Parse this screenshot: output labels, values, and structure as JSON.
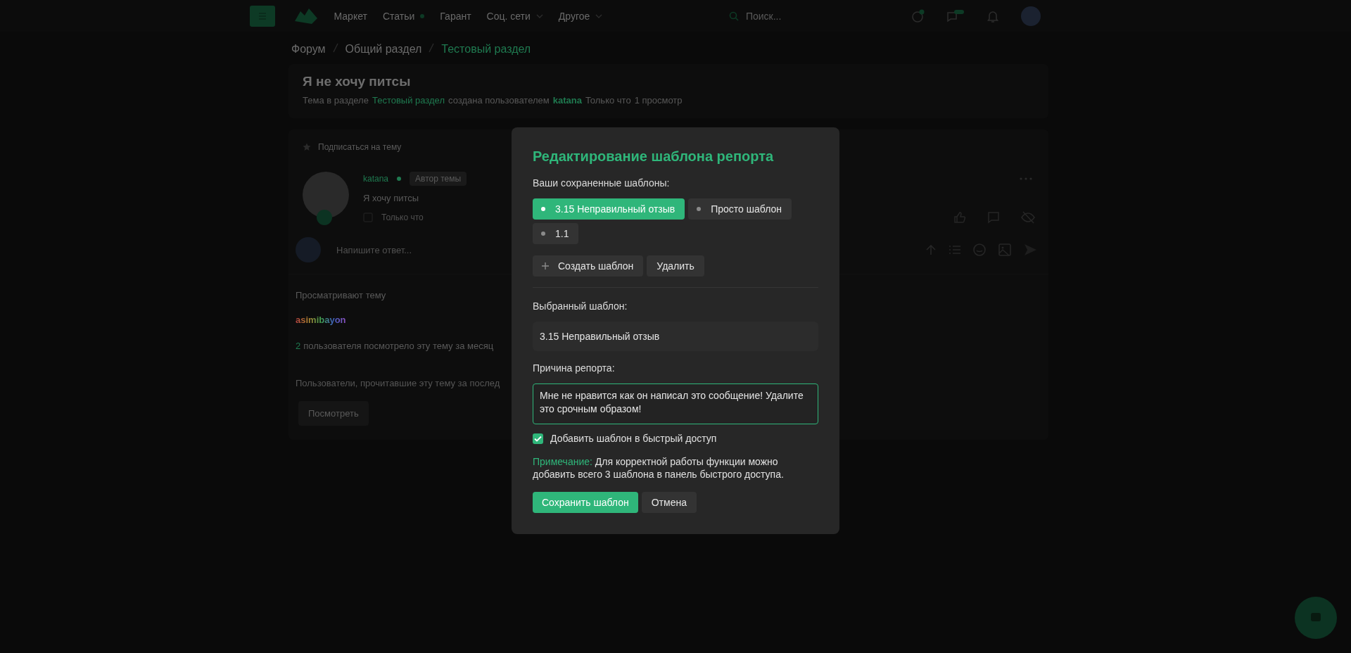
{
  "nav": {
    "items": [
      {
        "label": "Маркет",
        "kind": "plain"
      },
      {
        "label": "Статьи",
        "kind": "dot"
      },
      {
        "label": "Гарант",
        "kind": "plain"
      },
      {
        "label": "Соц. сети",
        "kind": "dropdown"
      },
      {
        "label": "Другое",
        "kind": "dropdown"
      }
    ],
    "search": {
      "placeholder": "Поиск..."
    }
  },
  "breadcrumbs": [
    {
      "label": "Форум",
      "current": false
    },
    {
      "label": "Общий раздел",
      "current": false
    },
    {
      "label": "Тестовый раздел",
      "current": true
    }
  ],
  "thread": {
    "title": "Я не хочу питсы",
    "meta": [
      {
        "text": "Тема в разделе",
        "kind": "plain"
      },
      {
        "text": "Тестовый раздел",
        "kind": "link"
      },
      {
        "text": "создана пользователем",
        "kind": "plain"
      },
      {
        "text": "katana",
        "kind": "user"
      },
      {
        "text": "Только что",
        "kind": "plain"
      },
      {
        "text": "1 просмотр",
        "kind": "plain"
      }
    ]
  },
  "post": {
    "subscribe": "Подписаться на тему",
    "author": "katana",
    "author_badge": "Автор темы",
    "text": "Я хочу питсы",
    "time": "Только что",
    "reply_placeholder": "Напишите ответ..."
  },
  "viewers": {
    "heading": "Просматривают тему",
    "users": [
      "asimibayon"
    ],
    "month_count": "2",
    "month_text": "пользователя посмотрело эту тему за месяц",
    "readers_text": "Пользователи, прочитавшие эту тему за послед",
    "readers_button": "Посмотреть"
  },
  "modal": {
    "title": "Редактирование шаблона репорта",
    "saved_label": "Ваши сохраненные шаблоны:",
    "templates": [
      {
        "label": "3.15 Неправильный отзыв",
        "selected": true
      },
      {
        "label": "Просто шаблон",
        "selected": false
      },
      {
        "label": "1.1",
        "selected": false
      }
    ],
    "create_button": "Создать шаблон",
    "delete_button": "Удалить",
    "selected_label": "Выбранный шаблон:",
    "selected_value": "3.15 Неправильный отзыв",
    "reason_label": "Причина репорта:",
    "reason_value": "Мне не нравится как он написал это сообщение! Удалите это срочным образом!",
    "quick_access": {
      "label": "Добавить шаблон в быстрый доступ",
      "checked": true
    },
    "note": {
      "label": "Примечание:",
      "text": "Для корректной работы функции можно добавить всего 3 шаблона в панель быстрого доступа."
    },
    "save_button": "Сохранить шаблон",
    "cancel_button": "Отмена"
  }
}
